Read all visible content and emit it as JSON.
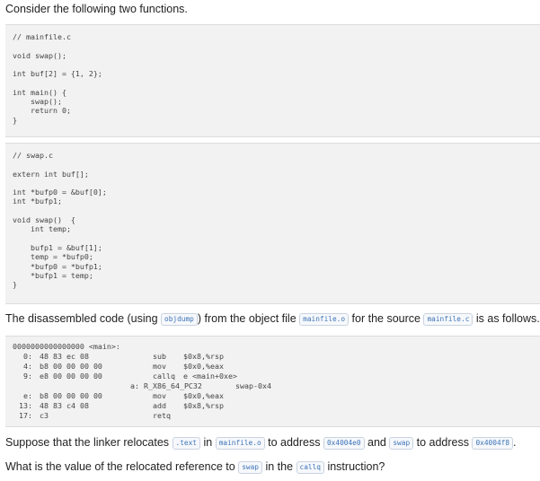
{
  "intro": "Consider the following two functions.",
  "mainfile_code": "// mainfile.c\n\nvoid swap();\n\nint buf[2] = {1, 2};\n\nint main() {\n    swap();\n    return 0;\n}",
  "swap_code": "// swap.c\n\nextern int buf[];\n\nint *bufp0 = &buf[0];\nint *bufp1;\n\nvoid swap()  {\n    int temp;\n\n    bufp1 = &buf[1];\n    temp = *bufp0;\n    *bufp0 = *bufp1;\n    *bufp1 = temp;\n}",
  "disasm_sentence": {
    "p1": "The disassembled code (using ",
    "c1": "objdump",
    "p2": ") from the object file ",
    "c2": "mainfile.o",
    "p3": " for the source ",
    "c3": "mainfile.c",
    "p4": " is as follows."
  },
  "disasm": {
    "header": "0000000000000000 <main>:",
    "rows": [
      {
        "addr": "0:",
        "bytes": "48 83 ec 08",
        "op": "sub",
        "arg": "$0x8,%rsp"
      },
      {
        "addr": "4:",
        "bytes": "b8 00 00 00 00",
        "op": "mov",
        "arg": "$0x0,%eax"
      },
      {
        "addr": "9:",
        "bytes": "e8 00 00 00 00",
        "op": "callq",
        "arg": "e <main+0xe>"
      },
      {
        "addr": "",
        "bytes": "",
        "op": "",
        "arg": ""
      },
      {
        "addr": "e:",
        "bytes": "b8 00 00 00 00",
        "op": "mov",
        "arg": "$0x0,%eax"
      },
      {
        "addr": "13:",
        "bytes": "48 83 c4 08",
        "op": "add",
        "arg": "$0x8,%rsp"
      },
      {
        "addr": "17:",
        "bytes": "c3",
        "op": "retq",
        "arg": ""
      }
    ],
    "reloc_left": "a: R_X86_64_PC32",
    "reloc_right": "swap-0x4"
  },
  "suppose": {
    "p1": "Suppose that the linker relocates ",
    "c1": ".text",
    "p2": " in ",
    "c2": "mainfile.o",
    "p3": " to address ",
    "c3": "0x4004e0",
    "p4": " and ",
    "c4": "swap",
    "p5": " to address ",
    "c5": "0x4004f8",
    "p6": "."
  },
  "question": {
    "p1": "What is the value of the relocated reference to ",
    "c1": "swap",
    "p2": " in the ",
    "c2": "callq",
    "p3": " instruction?"
  }
}
